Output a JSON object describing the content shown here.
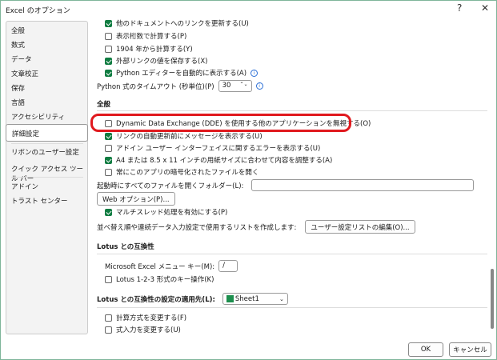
{
  "window": {
    "title": "Excel のオプション",
    "help": "?",
    "close": "✕"
  },
  "sidebar": {
    "items": [
      "全般",
      "数式",
      "データ",
      "文章校正",
      "保存",
      "言語",
      "アクセシビリティ",
      "詳細設定",
      "リボンのユーザー設定",
      "クイック アクセス ツール バー",
      "アドイン",
      "トラスト センター"
    ]
  },
  "top": [
    {
      "label": "他のドキュメントへのリンクを更新する(U)",
      "checked": true
    },
    {
      "label": "表示桁数で計算する(P)",
      "checked": false
    },
    {
      "label": "1904 年から計算する(Y)",
      "checked": false
    },
    {
      "label": "外部リンクの値を保存する(X)",
      "checked": true
    },
    {
      "label": "Python エディターを自動的に表示する(A)",
      "checked": true
    }
  ],
  "python_timeout": {
    "label": "Python 式のタイムアウト (秒単位)(P)",
    "value": "30"
  },
  "general": {
    "header": "全般",
    "items": [
      {
        "label": "Dynamic Data Exchange (DDE) を使用する他のアプリケーションを無視する(O)",
        "checked": false
      },
      {
        "label": "リンクの自動更新前にメッセージを表示する(U)",
        "checked": true
      },
      {
        "label": "アドイン ユーザー インターフェイスに関するエラーを表示する(U)",
        "checked": false
      },
      {
        "label": "A4 または 8.5 x 11 インチの用紙サイズに合わせて内容を調整する(A)",
        "checked": true
      },
      {
        "label": "常にこのアプリの暗号化されたファイルを開く",
        "checked": false
      }
    ],
    "startup_folder_label": "起動時にすべてのファイルを開くフォルダー(L):",
    "startup_folder_value": "",
    "web_options": "Web オプション(P)...",
    "multithread": {
      "label": "マルチスレッド処理を有効にする(P)",
      "checked": true
    },
    "sort_list_label": "並べ替え順や連続データ入力設定で使用するリストを作成します:",
    "sort_list_button": "ユーザー設定リストの編集(O)..."
  },
  "lotus": {
    "header": "Lotus との互換性",
    "menu_key_label": "Microsoft Excel メニュー キー(M):",
    "menu_key_value": "/",
    "nav_keys": {
      "label": "Lotus 1-2-3 形式のキー操作(K)",
      "checked": false
    }
  },
  "lotus_settings": {
    "header": "Lotus との互換性の設定の適用先(L):",
    "sheet": "Sheet1",
    "items": [
      {
        "label": "計算方式を変更する(F)",
        "checked": false
      },
      {
        "label": "式入力を変更する(U)",
        "checked": false
      }
    ]
  },
  "footer": {
    "ok": "OK",
    "cancel": "キャンセル"
  }
}
